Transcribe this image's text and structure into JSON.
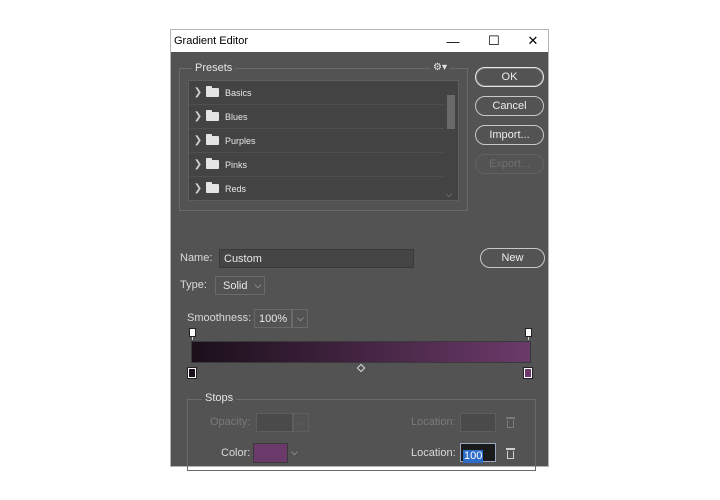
{
  "window": {
    "title": "Gradient Editor",
    "controls": {
      "minimize": "—",
      "maximize": "☐",
      "close": "✕"
    }
  },
  "presets": {
    "legend": "Presets",
    "gear_icon": "⚙▾",
    "items": [
      {
        "label": "Basics"
      },
      {
        "label": "Blues"
      },
      {
        "label": "Purples"
      },
      {
        "label": "Pinks"
      },
      {
        "label": "Reds"
      }
    ]
  },
  "buttons": {
    "ok": "OK",
    "cancel": "Cancel",
    "import": "Import...",
    "export": "Export...",
    "new": "New"
  },
  "name": {
    "label": "Name:",
    "value": "Custom"
  },
  "type": {
    "label": "Type:",
    "value": "Solid",
    "options": [
      "Solid"
    ]
  },
  "smoothness": {
    "label": "Smoothness:",
    "value": "100%"
  },
  "gradient": {
    "start_color": "#1b0f1a",
    "end_color": "#6b3a6a"
  },
  "stops": {
    "legend": "Stops",
    "opacity_label": "Opacity:",
    "location_label": "Location:",
    "color_label": "Color:",
    "color_value": "#6b3a6a",
    "color_location": "100"
  }
}
